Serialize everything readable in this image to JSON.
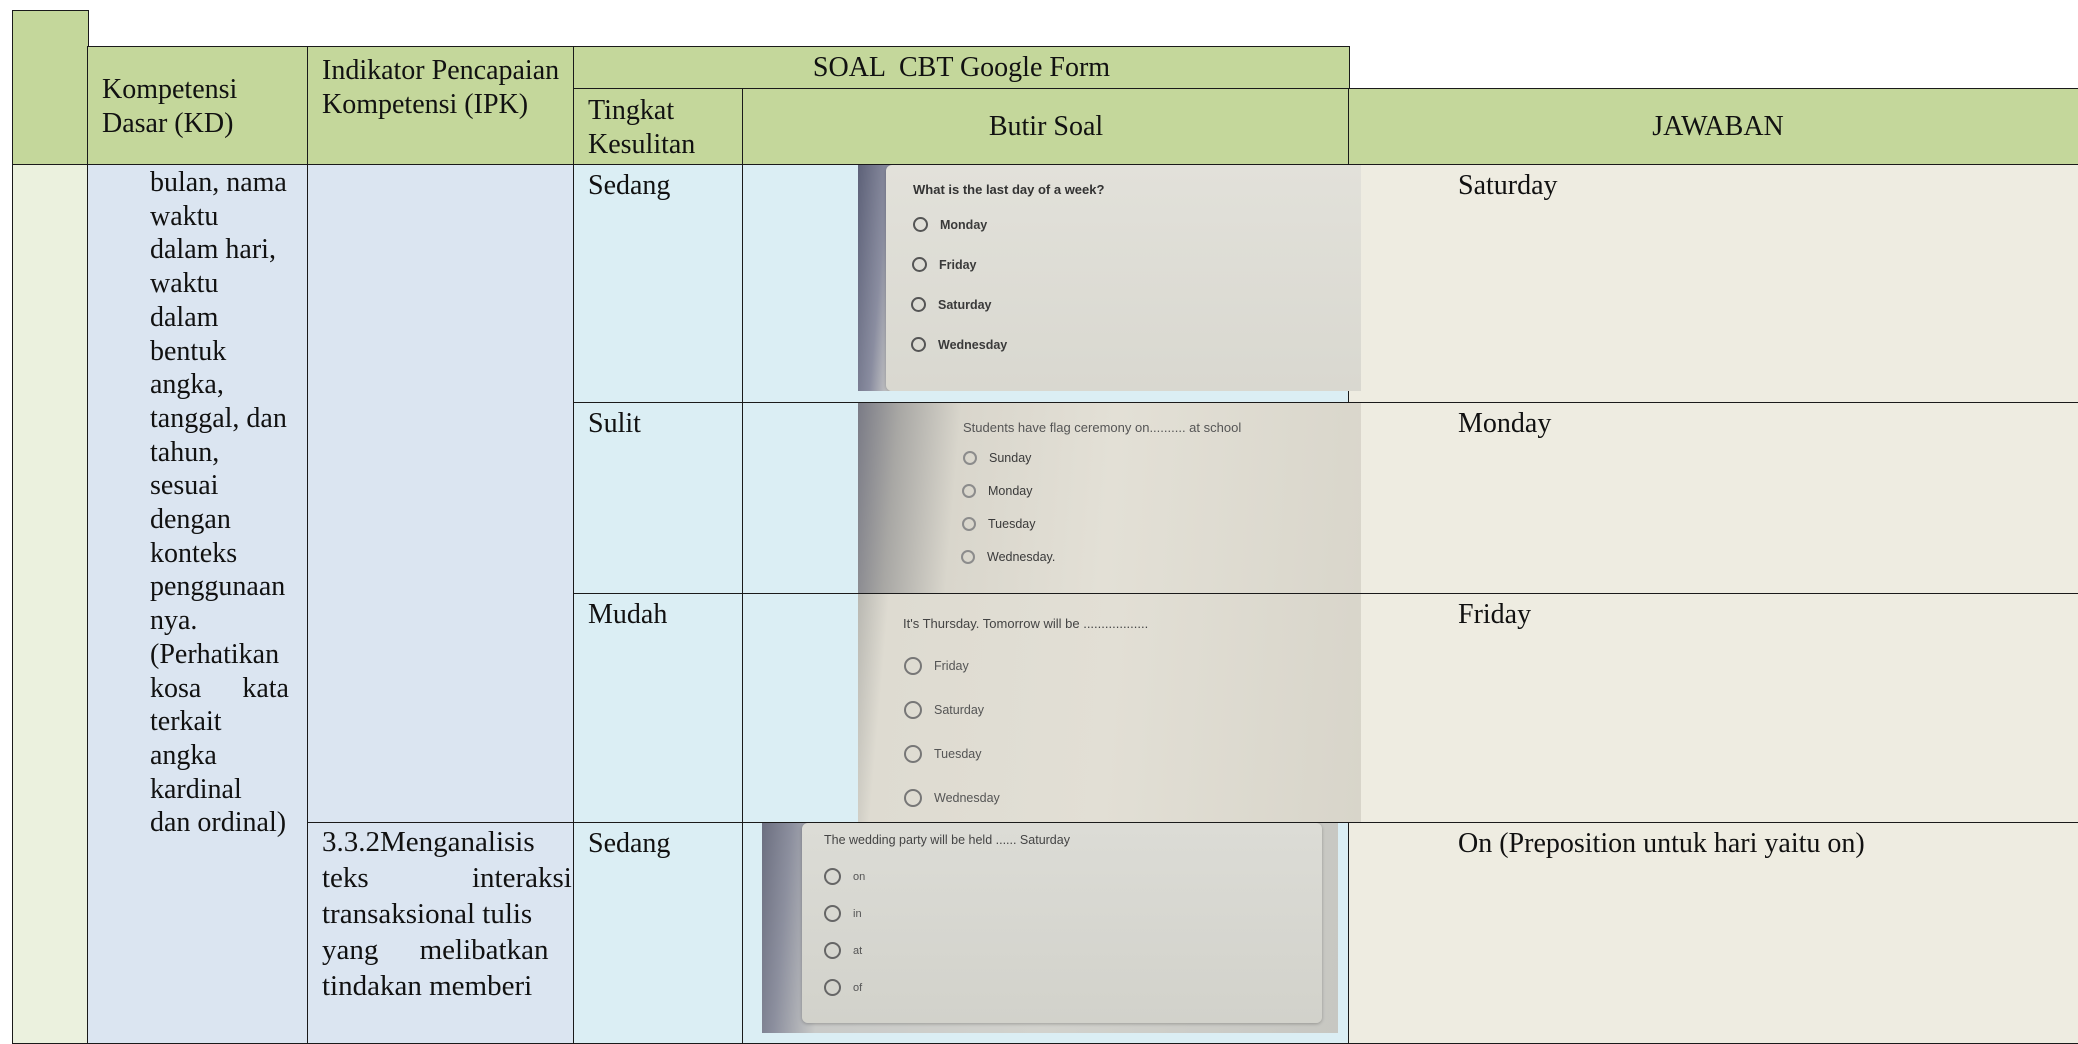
{
  "header": {
    "kd_label": "Kompetensi Dasar (KD)",
    "ipk_label": "Indikator Pencapaian Kompetensi (IPK)",
    "soal_label": "SOAL  CBT Google Form",
    "tingkat_label": "Tingkat Kesulitan",
    "butir_label": "Butir Soal",
    "jawaban_label": "JAWABAN"
  },
  "kd_text_lines": [
    "bulan, nama",
    "waktu",
    "dalam hari,",
    "waktu",
    "dalam",
    "bentuk",
    "angka,",
    "tanggal, dan",
    "tahun,",
    "sesuai",
    "dengan",
    "konteks",
    "penggunaan",
    "nya.",
    "(Perhatikan",
    "kosa kata",
    "terkait",
    "angka",
    "kardinal",
    "dan ordinal)"
  ],
  "ipk_text_lines": [
    "3.3.2Menganalisis",
    "teks interaksi",
    "transaksional tulis",
    "yang melibatkan",
    "tindakan memberi"
  ],
  "rows": [
    {
      "tingkat": "Sedang",
      "question": "What is the last day of a week?",
      "options": [
        "Monday",
        "Friday",
        "Saturday",
        "Wednesday"
      ],
      "jawaban": "Saturday"
    },
    {
      "tingkat": "Sulit",
      "question": "Students have flag ceremony on.......... at school",
      "options": [
        "Sunday",
        "Monday",
        "Tuesday",
        "Wednesday."
      ],
      "jawaban": "Monday"
    },
    {
      "tingkat": "Mudah",
      "question": "It's Thursday. Tomorrow will be ..................",
      "options": [
        "Friday",
        "Saturday",
        "Tuesday",
        "Wednesday"
      ],
      "jawaban": "Friday"
    },
    {
      "tingkat": "Sedang",
      "question": "The wedding party will be held ...... Saturday",
      "options": [
        "on",
        "in",
        "at",
        "of"
      ],
      "jawaban": "On (Preposition untuk hari yaitu on)"
    }
  ]
}
